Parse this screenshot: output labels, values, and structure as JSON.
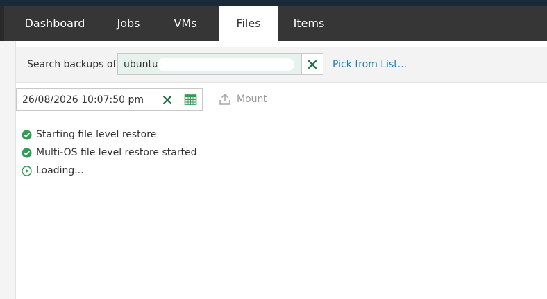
{
  "nav": {
    "tabs": [
      {
        "label": "Dashboard"
      },
      {
        "label": "Jobs"
      },
      {
        "label": "VMs"
      },
      {
        "label": "Files",
        "active": true
      },
      {
        "label": "Items"
      }
    ]
  },
  "search": {
    "label": "Search backups of:",
    "value": "ubuntu",
    "clear_icon": "close-icon",
    "pick_link": "Pick from List..."
  },
  "restore_point": {
    "date_value": "26/08/2026 10:07:50 pm",
    "clear_icon": "close-icon",
    "calendar_icon": "calendar-icon"
  },
  "mount": {
    "label": "Mount",
    "icon": "upload-icon",
    "enabled": false
  },
  "status": [
    {
      "text": "Starting file level restore",
      "icon": "check-circle-icon"
    },
    {
      "text": "Multi-OS file level restore started",
      "icon": "check-circle-icon"
    },
    {
      "text": "Loading...",
      "icon": "play-circle-icon"
    }
  ],
  "colors": {
    "accent_green": "#2e9e55",
    "link_blue": "#1a7bb9",
    "nav_bg": "#363636",
    "clear_green": "#1f6b43"
  }
}
